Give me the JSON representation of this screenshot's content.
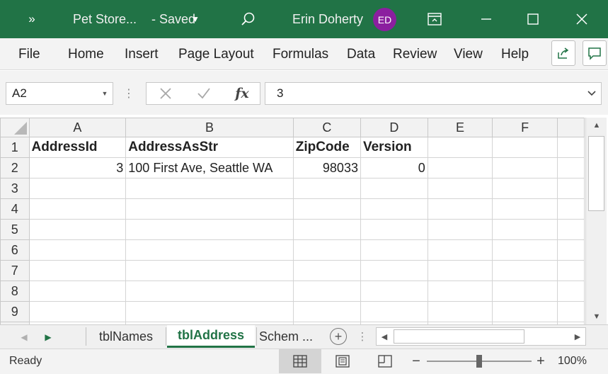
{
  "titlebar": {
    "quick_access_chevron": "»",
    "doc_title": "Pet Store...",
    "save_status": "-  Saved",
    "user_name": "Erin Doherty",
    "user_initials": "ED",
    "bg_color": "#217346",
    "avatar_color": "#8b1f9f"
  },
  "menu": {
    "items": [
      "File",
      "Home",
      "Insert",
      "Page Layout",
      "Formulas",
      "Data",
      "Review",
      "View",
      "Help"
    ]
  },
  "formula_bar": {
    "name_box": "A2",
    "fx_label": "fx",
    "value": "3"
  },
  "grid": {
    "columns": [
      "A",
      "B",
      "C",
      "D",
      "E",
      "F"
    ],
    "rows": [
      "1",
      "2",
      "3",
      "4",
      "5",
      "6",
      "7",
      "8",
      "9"
    ],
    "header_row": [
      "AddressId",
      "AddressAsStr",
      "ZipCode",
      "Version"
    ],
    "data_rows": [
      [
        "3",
        "100 First Ave, Seattle WA",
        "98033",
        "0"
      ]
    ]
  },
  "sheets": {
    "tabs": [
      "tblNames",
      "tblAddress",
      "Schem ..."
    ],
    "active": "tblAddress",
    "add_label": "+"
  },
  "status": {
    "ready": "Ready",
    "zoom_minus": "−",
    "zoom_plus": "+",
    "zoom_level": "100%",
    "zoom_fraction": 0.5
  },
  "colors": {
    "accent": "#217346"
  },
  "icons": {
    "search": "search-icon",
    "share": "share-icon",
    "comment": "comment-icon",
    "minimize": "minimize-icon",
    "maximize": "maximize-icon",
    "close": "close-icon"
  }
}
